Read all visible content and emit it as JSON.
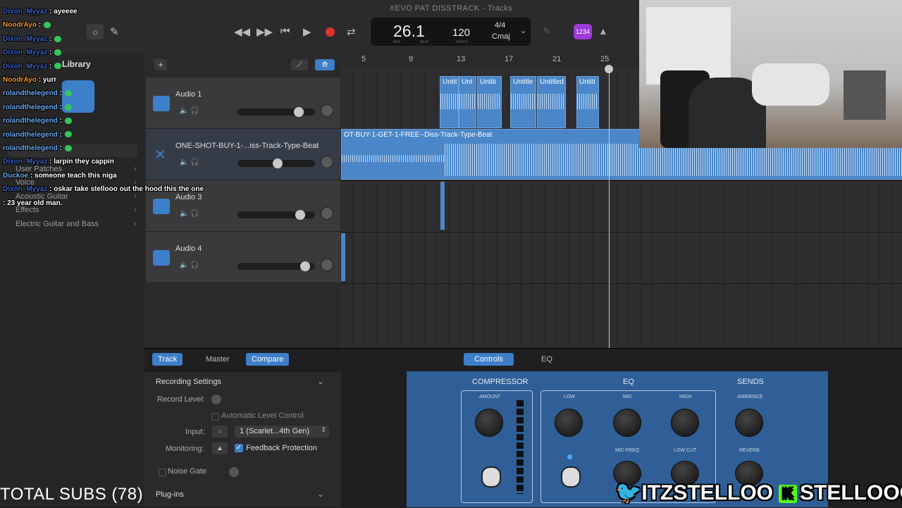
{
  "window": {
    "title": "XEVO PAT DISSTRACK - Tracks"
  },
  "lcd": {
    "bar_beat": "26.1",
    "bar_label": "BAR",
    "beat_label": "BEAT",
    "tempo": "120",
    "tempo_label": "TEMPO",
    "signature": "4/4",
    "key": "Cmaj"
  },
  "toolbar": {
    "count_in_badge": "1234"
  },
  "library": {
    "title": "Library",
    "items": [
      "User Patches",
      "Voice",
      "Acoustic Guitar",
      "Effects",
      "Electric Guitar and Bass"
    ]
  },
  "tracks": [
    {
      "name": "Audio 1"
    },
    {
      "name": "ONE-SHOT-BUY-1-...iss-Track-Type-Beat"
    },
    {
      "name": "Audio 3"
    },
    {
      "name": "Audio 4"
    }
  ],
  "ruler": [
    "5",
    "9",
    "13",
    "17",
    "21",
    "25"
  ],
  "regions": {
    "audio1": [
      "Untit",
      "Unt",
      "Untiti",
      "Untitle",
      "Untitled",
      "Untiti"
    ],
    "beat": "OT-BUY-1-GET-1-FREE--Diss-Track-Type-Beat"
  },
  "bottom_tabs": {
    "track": "Track",
    "master": "Master",
    "compare": "Compare",
    "controls": "Controls",
    "eq": "EQ"
  },
  "recording": {
    "header": "Recording Settings",
    "record_level": "Record Level:",
    "auto_level": "Automatic Level Control",
    "input_label": "Input:",
    "input_value": "1 (Scarlet...4th Gen)",
    "monitoring_label": "Monitoring:",
    "feedback": "Feedback Protection",
    "noise_gate": "Noise Gate",
    "plugins": "Plug-ins"
  },
  "plugin": {
    "compressor": "COMPRESSOR",
    "eq": "EQ",
    "sends": "SENDS",
    "amount": "AMOUNT",
    "low": "LOW",
    "mid": "MID",
    "high": "HIGH",
    "mid_freq": "MID FREQ",
    "low_cut": "LOW CUT",
    "ambience": "AMBIENCE",
    "reverb": "REVERB"
  },
  "chat": [
    {
      "user": "Dixon_Myyaz",
      "msg": ": ayeeee",
      "color": "blue"
    },
    {
      "user": "NoodrAyo",
      "msg": ":",
      "color": "orange"
    },
    {
      "user": "Dixon_Myyaz",
      "msg": ":",
      "color": "blue"
    },
    {
      "user": "Dixon_Myyaz",
      "msg": ":",
      "color": "blue"
    },
    {
      "user": "Dixon_Myyaz",
      "msg": ":",
      "color": "blue"
    },
    {
      "user": "NoodrAyo",
      "msg": ": yurr",
      "color": "orange"
    },
    {
      "user": "rolandthelegend",
      "msg": ":",
      "color": "blue2"
    },
    {
      "user": "rolandthelegend",
      "msg": ":",
      "color": "blue2"
    },
    {
      "user": "rolandthelegend",
      "msg": ":",
      "color": "blue2"
    },
    {
      "user": "rolandthelegend",
      "msg": ":",
      "color": "blue2"
    },
    {
      "user": "rolandthelegend",
      "msg": ":",
      "color": "blue2"
    },
    {
      "user": "Dixon_Myyaz",
      "msg": ": larpin they cappin",
      "color": "blue"
    },
    {
      "user": "Duckoe",
      "msg": ": someone teach this niga",
      "color": "blue2"
    },
    {
      "user": "Dixon_Myyaz",
      "msg": ": oskar take stellooo out the hood this the one",
      "color": "blue"
    },
    {
      "user": "",
      "msg": ": 23 year old man.",
      "color": "red"
    }
  ],
  "overlay": {
    "subs": "TOTAL SUBS (78)",
    "twitter": "ITZSTELLOO",
    "kick": "STELLOOO",
    "kick_letter": "K"
  },
  "colors": {
    "accent": "#3d7fc9",
    "record": "#e0312a",
    "plugin_bg": "#2f5f96",
    "kick": "#53fc18",
    "twitter": "#1d9bf0"
  }
}
